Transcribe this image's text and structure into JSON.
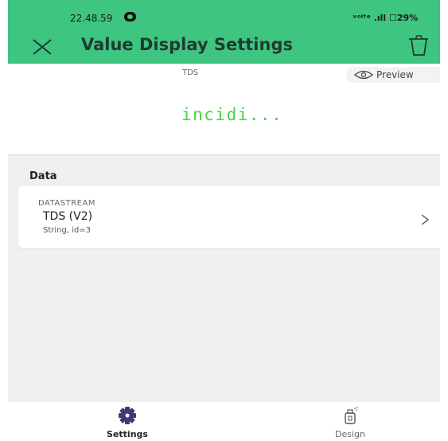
{
  "status_bar": {
    "time": "22.48.59",
    "right_text": "ᵛᵒˡᵗᵉ .ıll ☐29%"
  },
  "header": {
    "title": "Value Display Settings",
    "close_icon": "close-icon",
    "trash_icon": "trash-icon",
    "color": "#3ec57f"
  },
  "preview": {
    "widget_label": "TDS",
    "preview_label": "Preview",
    "value": "incidi...",
    "value_color": "#4ad443"
  },
  "data_section": {
    "title": "Data",
    "datastream": {
      "kicker": "DATASTREAM",
      "name": "TDS (V2)",
      "sub": "String, id=3"
    }
  },
  "bottom_nav": {
    "settings_label": "Settings",
    "design_label": "Design"
  }
}
